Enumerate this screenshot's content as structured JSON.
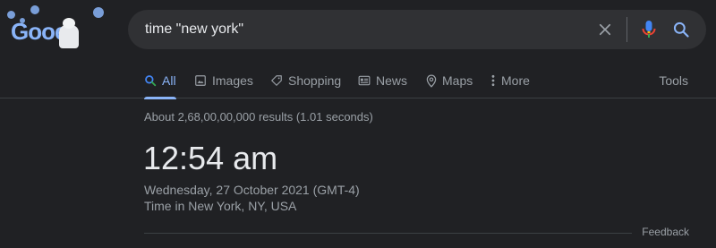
{
  "logo": {
    "text": "Gooe"
  },
  "search": {
    "query": "time \"new york\"",
    "clear_icon": "close-icon",
    "voice_icon": "microphone-icon",
    "search_icon": "search-icon"
  },
  "tabs": [
    {
      "label": "All",
      "icon": "search-icon",
      "active": true
    },
    {
      "label": "Images",
      "icon": "image-icon",
      "active": false
    },
    {
      "label": "Shopping",
      "icon": "tag-icon",
      "active": false
    },
    {
      "label": "News",
      "icon": "news-icon",
      "active": false
    },
    {
      "label": "Maps",
      "icon": "map-pin-icon",
      "active": false
    },
    {
      "label": "More",
      "icon": "more-vert-icon",
      "active": false
    }
  ],
  "tools_label": "Tools",
  "results": {
    "stats": "About 2,68,00,00,000 results (1.01 seconds)",
    "time": "12:54 am",
    "date": "Wednesday, 27 October 2021 (GMT-4)",
    "place": "Time in New York, NY, USA",
    "feedback": "Feedback"
  },
  "colors": {
    "background": "#202124",
    "search_bg": "#303134",
    "accent": "#8ab4f8",
    "text_primary": "#e8eaed",
    "text_secondary": "#9aa0a6"
  }
}
